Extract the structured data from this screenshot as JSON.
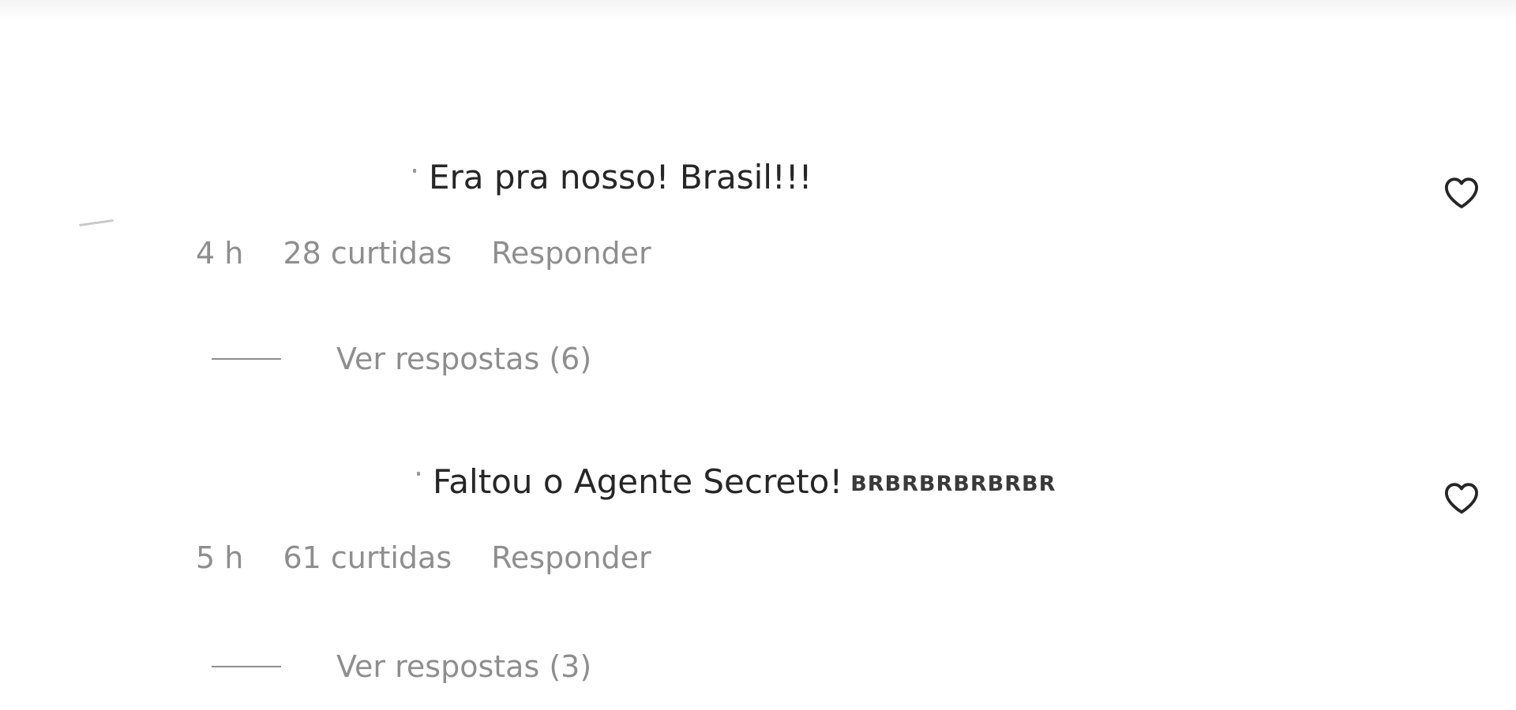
{
  "comments": [
    {
      "text": "Era pra nosso! Brasil!!!",
      "suffix": "",
      "time": "4 h",
      "likes": "28 curtidas",
      "reply_label": "Responder",
      "view_replies": "Ver respostas (6)",
      "like_icon": "heart-outline-icon"
    },
    {
      "text": "Faltou o Agente Secreto!",
      "suffix": "BRBRBRBRBRBR",
      "time": "5 h",
      "likes": "61 curtidas",
      "reply_label": "Responder",
      "view_replies": "Ver respostas (3)",
      "like_icon": "heart-outline-icon"
    }
  ],
  "colors": {
    "primary_text": "#262626",
    "secondary_text": "#8e8e8e",
    "background": "#ffffff"
  }
}
